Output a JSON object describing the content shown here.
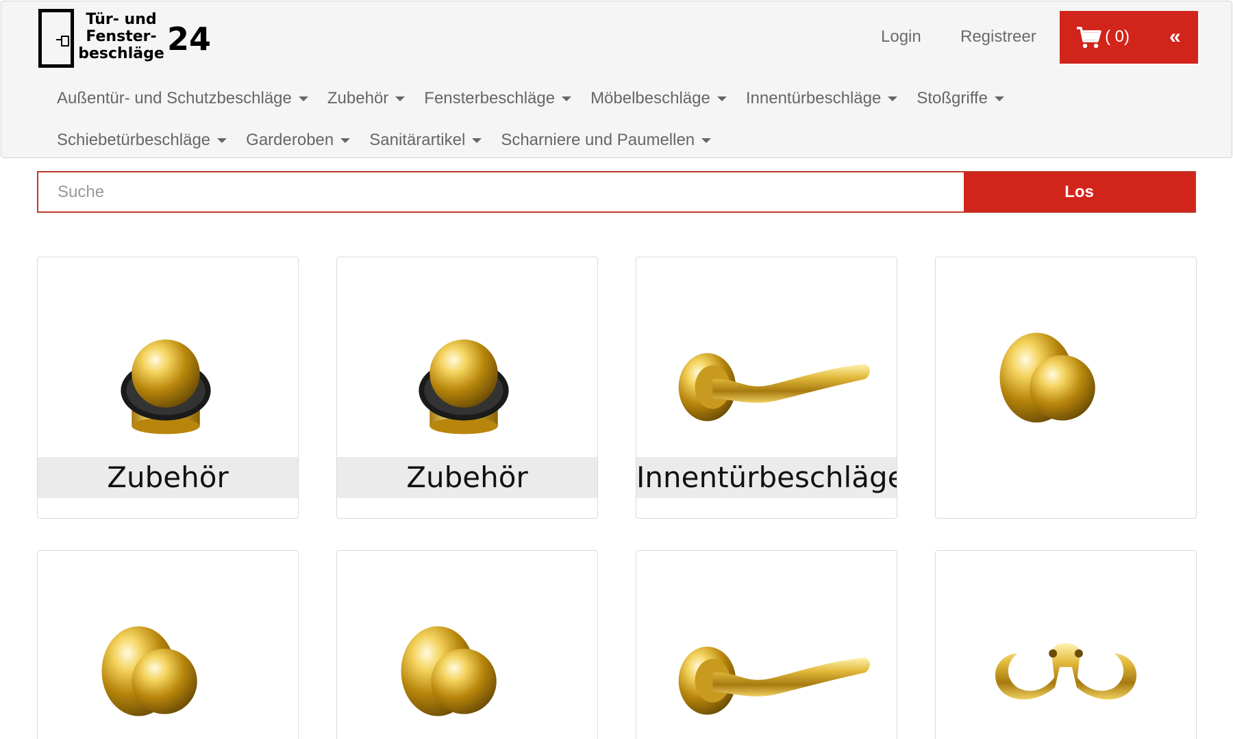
{
  "logo": {
    "line1": "Tür- und",
    "line2": "Fenster-",
    "line3": "beschläge",
    "number": "24"
  },
  "header": {
    "login": "Login",
    "register": "Registreer",
    "cart_count": "( 0)",
    "collapse": "«"
  },
  "nav": {
    "row1": [
      "Außentür- und Schutzbeschläge",
      "Zubehör",
      "Fensterbeschläge",
      "Möbelbeschläge",
      "Innentürbeschläge",
      "Stoßgriffe"
    ],
    "row2": [
      "Schiebetürbeschläge",
      "Garderoben",
      "Sanitärartikel",
      "Scharniere und Paumellen"
    ]
  },
  "search": {
    "placeholder": "Suche",
    "button": "Los"
  },
  "products": [
    {
      "label": "Zubehör",
      "icon": "door-stop-icon"
    },
    {
      "label": "Zubehör",
      "icon": "door-stop-icon"
    },
    {
      "label": "Innentürbeschläge",
      "icon": "door-handle-icon"
    },
    {
      "label": "",
      "icon": "door-knob-icon"
    },
    {
      "label": "",
      "icon": "door-knob-icon"
    },
    {
      "label": "",
      "icon": "door-knob-icon"
    },
    {
      "label": "",
      "icon": "door-handle-icon"
    },
    {
      "label": "",
      "icon": "coat-hook-icon"
    }
  ],
  "colors": {
    "accent": "#d1241b",
    "gold": "#d4a820",
    "header_bg": "#f5f5f5"
  }
}
